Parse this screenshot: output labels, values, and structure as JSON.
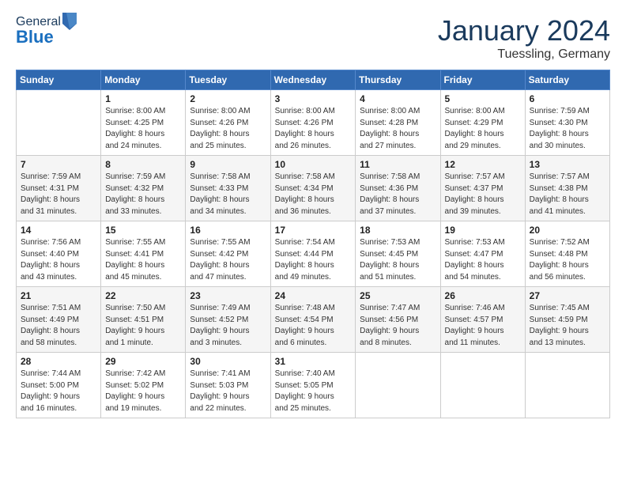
{
  "header": {
    "logo_line1": "General",
    "logo_line2": "Blue",
    "month": "January 2024",
    "location": "Tuessling, Germany"
  },
  "weekdays": [
    "Sunday",
    "Monday",
    "Tuesday",
    "Wednesday",
    "Thursday",
    "Friday",
    "Saturday"
  ],
  "weeks": [
    [
      {
        "day": "",
        "info": ""
      },
      {
        "day": "1",
        "info": "Sunrise: 8:00 AM\nSunset: 4:25 PM\nDaylight: 8 hours\nand 24 minutes."
      },
      {
        "day": "2",
        "info": "Sunrise: 8:00 AM\nSunset: 4:26 PM\nDaylight: 8 hours\nand 25 minutes."
      },
      {
        "day": "3",
        "info": "Sunrise: 8:00 AM\nSunset: 4:26 PM\nDaylight: 8 hours\nand 26 minutes."
      },
      {
        "day": "4",
        "info": "Sunrise: 8:00 AM\nSunset: 4:28 PM\nDaylight: 8 hours\nand 27 minutes."
      },
      {
        "day": "5",
        "info": "Sunrise: 8:00 AM\nSunset: 4:29 PM\nDaylight: 8 hours\nand 29 minutes."
      },
      {
        "day": "6",
        "info": "Sunrise: 7:59 AM\nSunset: 4:30 PM\nDaylight: 8 hours\nand 30 minutes."
      }
    ],
    [
      {
        "day": "7",
        "info": "Sunrise: 7:59 AM\nSunset: 4:31 PM\nDaylight: 8 hours\nand 31 minutes."
      },
      {
        "day": "8",
        "info": "Sunrise: 7:59 AM\nSunset: 4:32 PM\nDaylight: 8 hours\nand 33 minutes."
      },
      {
        "day": "9",
        "info": "Sunrise: 7:58 AM\nSunset: 4:33 PM\nDaylight: 8 hours\nand 34 minutes."
      },
      {
        "day": "10",
        "info": "Sunrise: 7:58 AM\nSunset: 4:34 PM\nDaylight: 8 hours\nand 36 minutes."
      },
      {
        "day": "11",
        "info": "Sunrise: 7:58 AM\nSunset: 4:36 PM\nDaylight: 8 hours\nand 37 minutes."
      },
      {
        "day": "12",
        "info": "Sunrise: 7:57 AM\nSunset: 4:37 PM\nDaylight: 8 hours\nand 39 minutes."
      },
      {
        "day": "13",
        "info": "Sunrise: 7:57 AM\nSunset: 4:38 PM\nDaylight: 8 hours\nand 41 minutes."
      }
    ],
    [
      {
        "day": "14",
        "info": "Sunrise: 7:56 AM\nSunset: 4:40 PM\nDaylight: 8 hours\nand 43 minutes."
      },
      {
        "day": "15",
        "info": "Sunrise: 7:55 AM\nSunset: 4:41 PM\nDaylight: 8 hours\nand 45 minutes."
      },
      {
        "day": "16",
        "info": "Sunrise: 7:55 AM\nSunset: 4:42 PM\nDaylight: 8 hours\nand 47 minutes."
      },
      {
        "day": "17",
        "info": "Sunrise: 7:54 AM\nSunset: 4:44 PM\nDaylight: 8 hours\nand 49 minutes."
      },
      {
        "day": "18",
        "info": "Sunrise: 7:53 AM\nSunset: 4:45 PM\nDaylight: 8 hours\nand 51 minutes."
      },
      {
        "day": "19",
        "info": "Sunrise: 7:53 AM\nSunset: 4:47 PM\nDaylight: 8 hours\nand 54 minutes."
      },
      {
        "day": "20",
        "info": "Sunrise: 7:52 AM\nSunset: 4:48 PM\nDaylight: 8 hours\nand 56 minutes."
      }
    ],
    [
      {
        "day": "21",
        "info": "Sunrise: 7:51 AM\nSunset: 4:49 PM\nDaylight: 8 hours\nand 58 minutes."
      },
      {
        "day": "22",
        "info": "Sunrise: 7:50 AM\nSunset: 4:51 PM\nDaylight: 9 hours\nand 1 minute."
      },
      {
        "day": "23",
        "info": "Sunrise: 7:49 AM\nSunset: 4:52 PM\nDaylight: 9 hours\nand 3 minutes."
      },
      {
        "day": "24",
        "info": "Sunrise: 7:48 AM\nSunset: 4:54 PM\nDaylight: 9 hours\nand 6 minutes."
      },
      {
        "day": "25",
        "info": "Sunrise: 7:47 AM\nSunset: 4:56 PM\nDaylight: 9 hours\nand 8 minutes."
      },
      {
        "day": "26",
        "info": "Sunrise: 7:46 AM\nSunset: 4:57 PM\nDaylight: 9 hours\nand 11 minutes."
      },
      {
        "day": "27",
        "info": "Sunrise: 7:45 AM\nSunset: 4:59 PM\nDaylight: 9 hours\nand 13 minutes."
      }
    ],
    [
      {
        "day": "28",
        "info": "Sunrise: 7:44 AM\nSunset: 5:00 PM\nDaylight: 9 hours\nand 16 minutes."
      },
      {
        "day": "29",
        "info": "Sunrise: 7:42 AM\nSunset: 5:02 PM\nDaylight: 9 hours\nand 19 minutes."
      },
      {
        "day": "30",
        "info": "Sunrise: 7:41 AM\nSunset: 5:03 PM\nDaylight: 9 hours\nand 22 minutes."
      },
      {
        "day": "31",
        "info": "Sunrise: 7:40 AM\nSunset: 5:05 PM\nDaylight: 9 hours\nand 25 minutes."
      },
      {
        "day": "",
        "info": ""
      },
      {
        "day": "",
        "info": ""
      },
      {
        "day": "",
        "info": ""
      }
    ]
  ]
}
